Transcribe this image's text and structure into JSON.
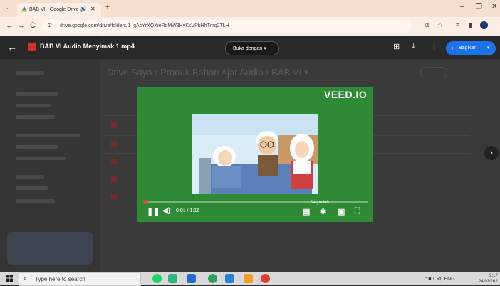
{
  "browser": {
    "tab_title": "BAB VI - Google Drive",
    "new_tab": "+",
    "url": "drive.google.com/drive/folders/1_gAcYrXQXieRoMW3HyKsVPbHhTmq2TLH",
    "back": "←",
    "forward": "→",
    "reload": "C"
  },
  "drive": {
    "breadcrumb": "Drive Saya  ›  Produk Bahan Ajar Audio  ›  BAB VI ▾"
  },
  "viewer": {
    "file_name": "BAB VI Audio Menyimak 1.mp4",
    "open_with": "Buka dengan ▾",
    "share_label": "Bagikan",
    "share_dropdown": "▾"
  },
  "video": {
    "brand": "VEED.IO",
    "watermark": "Saepulloh",
    "current_time": "0:01",
    "duration": "1:16",
    "time_display": "0:01 / 1:16",
    "progress_fraction": 0.013
  },
  "taskbar": {
    "search_placeholder": "Type here to search",
    "tray": "^ ■ ☇ ⊲) ENG",
    "time": "9:17",
    "date": "24/03/202"
  },
  "colors": {
    "share": "#1a73e8",
    "video_bg": "#2f8a35",
    "progress": "#ff3b3b"
  }
}
